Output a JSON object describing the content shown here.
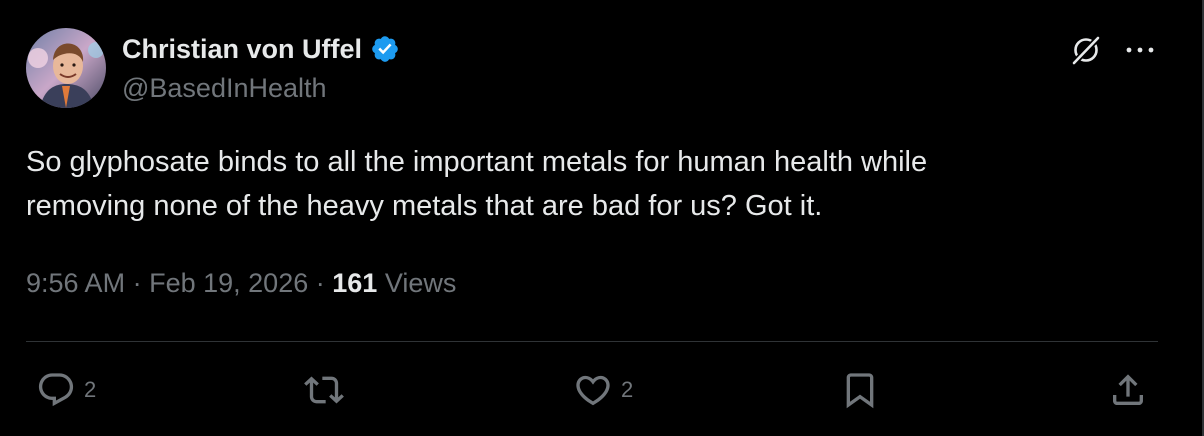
{
  "tweet": {
    "author": {
      "display_name": "Christian von Uffel",
      "handle": "@BasedInHealth",
      "verified": true,
      "avatar_icon": "profile-photo"
    },
    "text": "So glyphosate binds to all the important metals for human health while\nremoving none of the heavy metals that are bad for us? Got it.",
    "time": "9:56 AM",
    "date": "Feb 19, 2026",
    "separator": "·",
    "views_count": "161",
    "views_label": "Views"
  },
  "actions": {
    "reply": {
      "icon": "reply-icon",
      "count": "2"
    },
    "retweet": {
      "icon": "retweet-icon",
      "count": ""
    },
    "like": {
      "icon": "heart-icon",
      "count": "2"
    },
    "bookmark": {
      "icon": "bookmark-icon"
    },
    "share": {
      "icon": "share-icon"
    }
  },
  "header_buttons": {
    "grok": {
      "icon": "grok-icon"
    },
    "more": {
      "icon": "more-icon"
    }
  },
  "colors": {
    "background": "#000000",
    "text_primary": "#e7e9ea",
    "text_secondary": "#71767b",
    "verified_blue": "#1d9bf0",
    "divider": "#2f3336"
  }
}
